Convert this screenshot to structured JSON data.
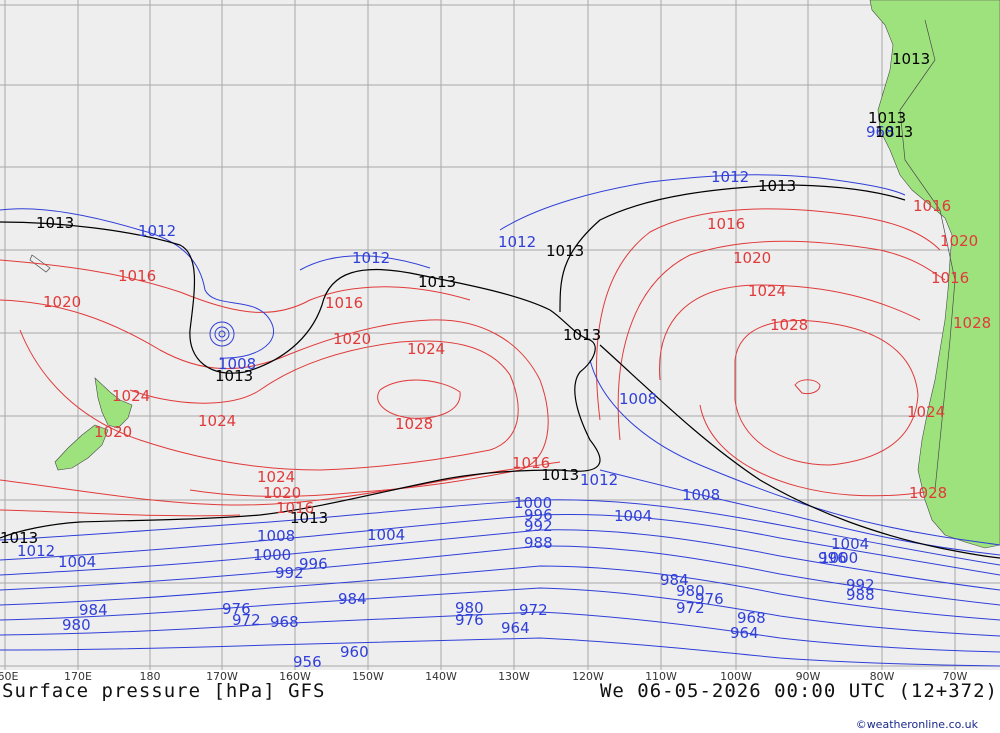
{
  "title": "Surface pressure [hPa] GFS",
  "valid_time": "We 06-05-2026 00:00 UTC (12+372)",
  "credit": "©weatheronline.co.uk",
  "colors": {
    "ocean": "#eeeeee",
    "land": "#9ee27e",
    "high_isobar": "#e03a3a",
    "low_isobar": "#2f3fd8",
    "standard_isobar": "#000000",
    "grid": "#a8a8a8"
  },
  "longitude_labels": [
    "60E",
    "170E",
    "180",
    "170W",
    "160W",
    "150W",
    "140W",
    "130W",
    "120W",
    "110W",
    "100W",
    "90W",
    "80W",
    "70W"
  ],
  "isobar_labels": {
    "standard": [
      "1013",
      "1013",
      "1013",
      "1013",
      "1013",
      "1013",
      "1013",
      "1013",
      "1013",
      "1013",
      "1013",
      "1013"
    ],
    "high": [
      "1016",
      "1020",
      "1024",
      "1020",
      "1024",
      "1016",
      "1020",
      "1024",
      "1028",
      "1024",
      "1020",
      "1016",
      "1016",
      "1020",
      "1024",
      "1028",
      "1024",
      "1028",
      "1016",
      "1020",
      "1016",
      "1028",
      "1016"
    ],
    "low": [
      "1012",
      "1012",
      "1012",
      "1008",
      "1012",
      "1008",
      "1012",
      "1008",
      "1004",
      "1000",
      "996",
      "992",
      "988",
      "984",
      "980",
      "976",
      "972",
      "968",
      "964",
      "960",
      "956",
      "1004",
      "1000",
      "996",
      "992",
      "984",
      "980",
      "976",
      "972",
      "968",
      "964",
      "1004",
      "1000",
      "996",
      "992",
      "988",
      "984",
      "980",
      "976",
      "972",
      "968",
      "1012",
      "1008",
      "1004"
    ]
  }
}
